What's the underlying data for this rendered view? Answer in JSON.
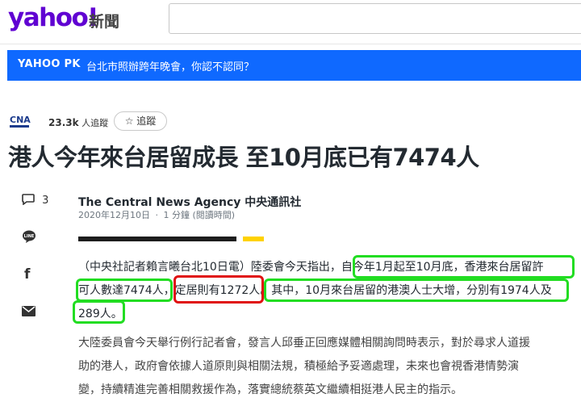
{
  "header": {
    "logo_text": "yahoo!",
    "section": "新聞",
    "search_placeholder": ""
  },
  "banner": {
    "tag": "YAHOO PK",
    "headline": "台北市照辦跨年晚會，你認不認同？"
  },
  "source": {
    "logo": "CNA",
    "followers_count": "23.3k",
    "followers_label": "人追蹤",
    "follow_icon": "☆",
    "follow_label": "追蹤"
  },
  "article": {
    "title": "港人今年來台居留成長 至10月底已有7474人",
    "comment_count": "3",
    "provider": "The Central News Agency 中央通訊社",
    "date": "2020年12月10日",
    "read_time": "1 分鐘 (閱讀時間)",
    "para1": [
      "（中央社記者賴言曦台北10日電）陸委會今天指出，自今年1月起至10月底，香港來台居留許",
      "可人數達7474人，定居則有1272人。其中，10月來台居留的港澳人士大增，分別有1974人及",
      "289人。"
    ],
    "para2": [
      "大陸委員會今天舉行例行記者會，發言人邱垂正回應媒體相關詢問時表示，對於尋求人道援",
      "助的港人，政府會依據人道原則與相關法規，積極給予妥適處理，未來也會視香港情勢演",
      "變，持續精進完善相關救援作為，落實總統蔡英文繼續相挺港人民主的指示。"
    ]
  },
  "share": {
    "comment_icon": "speech-bubble",
    "line_icon": "LINE",
    "facebook_icon": "f",
    "mail_icon": "envelope"
  },
  "colors": {
    "brand": "#6001d2",
    "banner": "#0f69ff",
    "highlight_green": "#22dd22",
    "highlight_red": "#e01010"
  }
}
